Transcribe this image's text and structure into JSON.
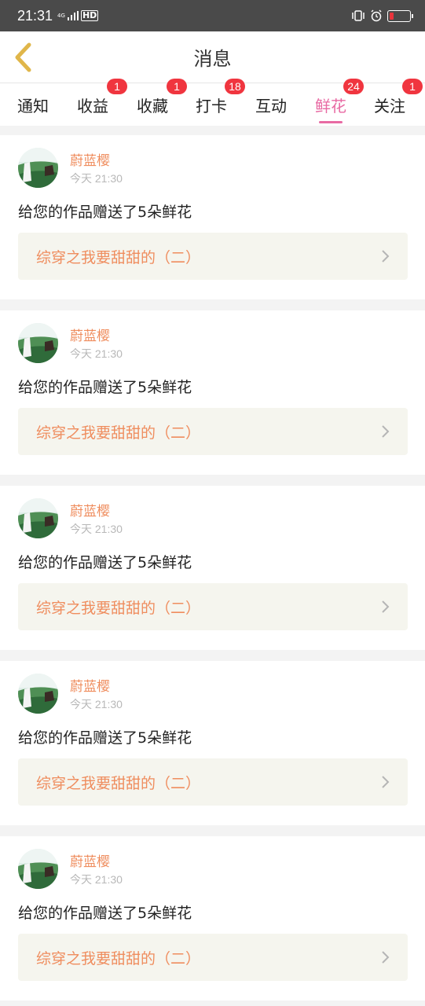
{
  "status_bar": {
    "time": "21:31",
    "network": "4G",
    "hd": "HD",
    "battery_level": 0.2,
    "battery_color": "#e8343c"
  },
  "header": {
    "title": "消息",
    "back_icon": "chevron-left-icon"
  },
  "tabs": [
    {
      "label": "通知",
      "badge": ""
    },
    {
      "label": "收益",
      "badge": "1"
    },
    {
      "label": "收藏",
      "badge": "1"
    },
    {
      "label": "打卡",
      "badge": "18"
    },
    {
      "label": "互动",
      "badge": ""
    },
    {
      "label": "鲜花",
      "badge": "24",
      "active": true
    },
    {
      "label": "关注",
      "badge": "1"
    }
  ],
  "messages": [
    {
      "user": "蔚蓝樱",
      "time": "今天 21:30",
      "text": "给您的作品赠送了5朵鲜花",
      "work": "综穿之我要甜甜的（二）"
    },
    {
      "user": "蔚蓝樱",
      "time": "今天 21:30",
      "text": "给您的作品赠送了5朵鲜花",
      "work": "综穿之我要甜甜的（二）"
    },
    {
      "user": "蔚蓝樱",
      "time": "今天 21:30",
      "text": "给您的作品赠送了5朵鲜花",
      "work": "综穿之我要甜甜的（二）"
    },
    {
      "user": "蔚蓝樱",
      "time": "今天 21:30",
      "text": "给您的作品赠送了5朵鲜花",
      "work": "综穿之我要甜甜的（二）"
    },
    {
      "user": "蔚蓝樱",
      "time": "今天 21:30",
      "text": "给您的作品赠送了5朵鲜花",
      "work": "综穿之我要甜甜的（二）"
    }
  ],
  "colors": {
    "accent_pink": "#e86aa3",
    "username_orange": "#ef8d5e",
    "badge_red": "#f0353f",
    "back_gold": "#e0b64a"
  }
}
